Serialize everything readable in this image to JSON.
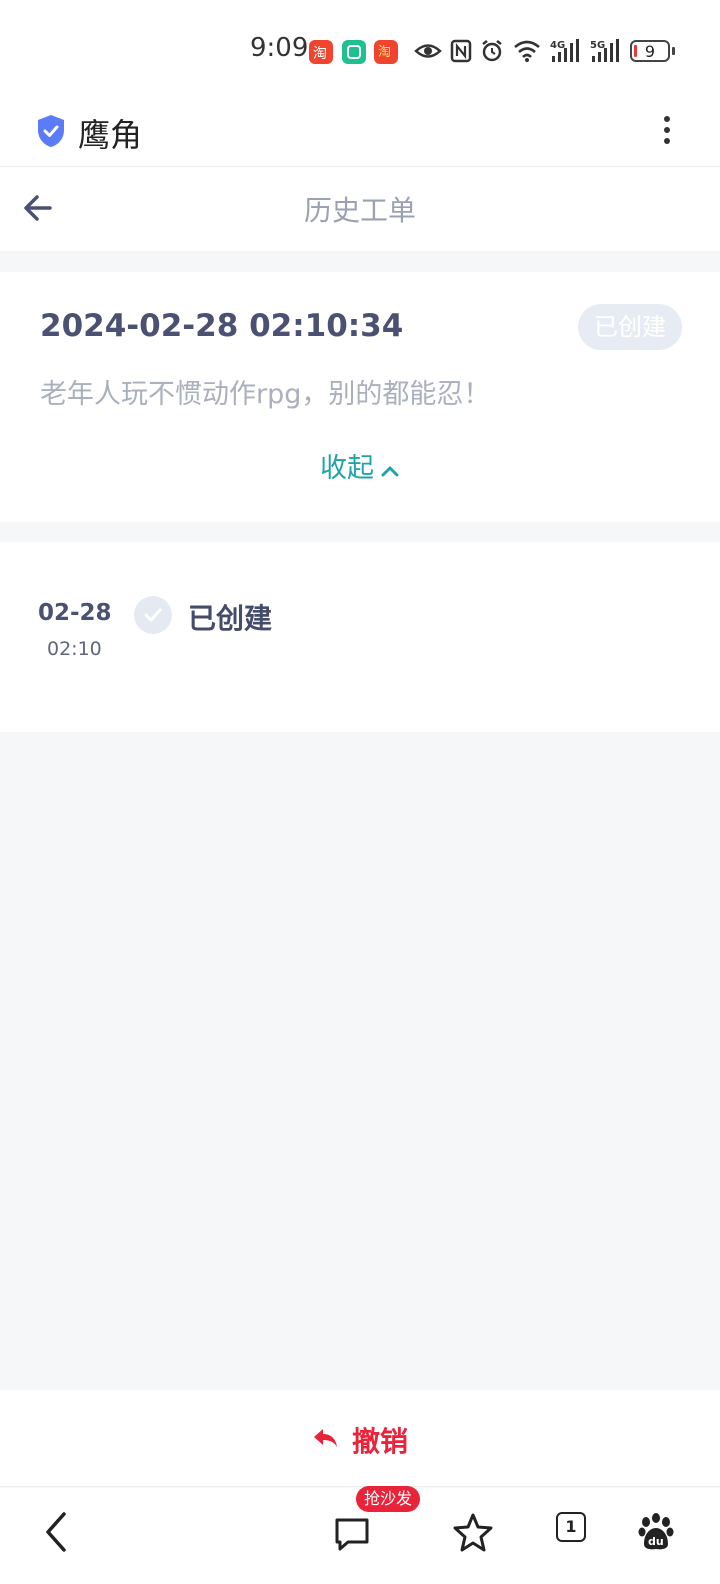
{
  "status_bar": {
    "time": "9:09",
    "battery": "9",
    "icons": [
      "taobao-icon",
      "mi-home-icon",
      "taobao-special-icon",
      "eye-icon",
      "nfc-icon",
      "alarm-icon",
      "wifi-icon",
      "signal-4g-icon",
      "signal-5g-icon",
      "battery-icon"
    ]
  },
  "app_header": {
    "title": "鹰角",
    "accent": "#5b7cf6"
  },
  "page_header": {
    "title": "历史工单"
  },
  "ticket": {
    "datetime": "2024-02-28 02:10:34",
    "status_badge": "已创建",
    "description": "老年人玩不惯动作rpg，别的都能忍！",
    "collapse_label": "收起"
  },
  "timeline": {
    "entries": [
      {
        "date": "02-28",
        "time": "02:10",
        "status": "已创建"
      }
    ]
  },
  "actions": {
    "revoke_label": "撤销",
    "revoke_color": "#e8233a"
  },
  "browser_nav": {
    "comment_badge": "抢沙发",
    "tab_count": "1",
    "icons": [
      "back-icon",
      "comment-icon",
      "favorite-star-icon",
      "tabs-icon",
      "baidu-paw-icon"
    ]
  },
  "colors": {
    "teal": "#21a4a8",
    "title_dark": "#4a5173",
    "muted": "#aab0bd"
  }
}
